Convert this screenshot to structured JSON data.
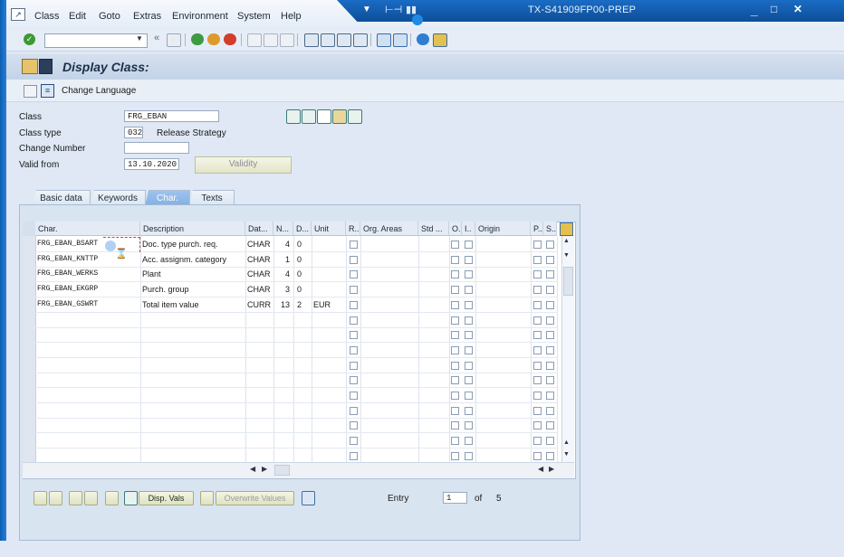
{
  "window": {
    "system_title": "TX-S41909FP00-PREP",
    "minimize": "_",
    "maximize": "□",
    "close": "✕"
  },
  "menu": {
    "items": [
      "Class",
      "Edit",
      "Goto",
      "Extras",
      "Environment",
      "System",
      "Help"
    ]
  },
  "screen": {
    "title": "Display Class:"
  },
  "app_toolbar": {
    "change_language": "Change Language"
  },
  "header": {
    "class_label": "Class",
    "class_value": "FRG_EBAN",
    "class_type_label": "Class type",
    "class_type_value": "032",
    "class_type_text": "Release Strategy",
    "change_number_label": "Change Number",
    "change_number_value": "",
    "valid_from_label": "Valid from",
    "valid_from_value": "13.10.2020",
    "validity_button": "Validity"
  },
  "tabs": [
    {
      "label": "Basic data",
      "active": false
    },
    {
      "label": "Keywords",
      "active": false
    },
    {
      "label": "Char.",
      "active": true
    },
    {
      "label": "Texts",
      "active": false
    }
  ],
  "table": {
    "columns": [
      "Char.",
      "Description",
      "Dat...",
      "N...",
      "D...",
      "Unit",
      "R..",
      "Org. Areas",
      "Std ...",
      "O..",
      "I..",
      "Origin",
      "P..",
      "S.."
    ],
    "rows": [
      {
        "char": "FRG_EBAN_BSART",
        "desc": "Doc. type purch. req.",
        "type": "CHAR",
        "n": "4",
        "d": "0",
        "unit": ""
      },
      {
        "char": "FRG_EBAN_KNTTP",
        "desc": "Acc. assignm. category",
        "type": "CHAR",
        "n": "1",
        "d": "0",
        "unit": ""
      },
      {
        "char": "FRG_EBAN_WERKS",
        "desc": "Plant",
        "type": "CHAR",
        "n": "4",
        "d": "0",
        "unit": ""
      },
      {
        "char": "FRG_EBAN_EKGRP",
        "desc": "Purch. group",
        "type": "CHAR",
        "n": "3",
        "d": "0",
        "unit": ""
      },
      {
        "char": "FRG_EBAN_GSWRT",
        "desc": "Total item value",
        "type": "CURR",
        "n": "13",
        "d": "2",
        "unit": "EUR"
      }
    ]
  },
  "bottom": {
    "disp_vals": "Disp. Vals",
    "overwrite_values": "Overwrite Values",
    "entry_label": "Entry",
    "entry_value": "1",
    "of_label": "of",
    "total": "5"
  }
}
